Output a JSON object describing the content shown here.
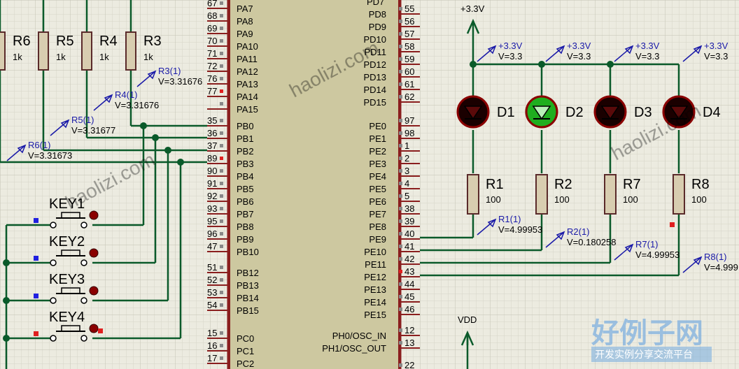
{
  "mcu": {
    "left_pins": [
      {
        "num": "67",
        "name": "PA7"
      },
      {
        "num": "68",
        "name": "PA8"
      },
      {
        "num": "69",
        "name": "PA9"
      },
      {
        "num": "70",
        "name": "PA10"
      },
      {
        "num": "71",
        "name": "PA11"
      },
      {
        "num": "72",
        "name": "PA12"
      },
      {
        "num": "76",
        "name": "PA13"
      },
      {
        "num": "77",
        "name": "PA14"
      },
      {
        "num": "",
        "name": "PA15"
      },
      {
        "num": "35",
        "name": "PB0"
      },
      {
        "num": "36",
        "name": "PB1"
      },
      {
        "num": "37",
        "name": "PB2"
      },
      {
        "num": "89",
        "name": "PB3"
      },
      {
        "num": "90",
        "name": "PB4"
      },
      {
        "num": "91",
        "name": "PB5"
      },
      {
        "num": "92",
        "name": "PB6"
      },
      {
        "num": "93",
        "name": "PB7"
      },
      {
        "num": "95",
        "name": "PB8"
      },
      {
        "num": "96",
        "name": "PB9"
      },
      {
        "num": "47",
        "name": "PB10"
      },
      {
        "num": "51",
        "name": "PB12"
      },
      {
        "num": "52",
        "name": "PB13"
      },
      {
        "num": "53",
        "name": "PB14"
      },
      {
        "num": "54",
        "name": "PB15"
      },
      {
        "num": "15",
        "name": "PC0"
      },
      {
        "num": "16",
        "name": "PC1"
      },
      {
        "num": "17",
        "name": "PC2"
      }
    ],
    "right_pins": [
      {
        "num": "55",
        "name": "PD8"
      },
      {
        "num": "56",
        "name": "PD9"
      },
      {
        "num": "57",
        "name": "PD10"
      },
      {
        "num": "58",
        "name": "PD11"
      },
      {
        "num": "59",
        "name": "PD12"
      },
      {
        "num": "60",
        "name": "PD13"
      },
      {
        "num": "61",
        "name": "PD14"
      },
      {
        "num": "62",
        "name": "PD15"
      },
      {
        "num": "97",
        "name": "PE0"
      },
      {
        "num": "98",
        "name": "PE1"
      },
      {
        "num": "1",
        "name": "PE2"
      },
      {
        "num": "2",
        "name": "PE3"
      },
      {
        "num": "3",
        "name": "PE4"
      },
      {
        "num": "4",
        "name": "PE5"
      },
      {
        "num": "5",
        "name": "PE6"
      },
      {
        "num": "38",
        "name": "PE7"
      },
      {
        "num": "39",
        "name": "PE8"
      },
      {
        "num": "40",
        "name": "PE9"
      },
      {
        "num": "41",
        "name": "PE10"
      },
      {
        "num": "42",
        "name": "PE11"
      },
      {
        "num": "43",
        "name": "PE12"
      },
      {
        "num": "44",
        "name": "PE13"
      },
      {
        "num": "45",
        "name": "PE14"
      },
      {
        "num": "46",
        "name": "PE15"
      },
      {
        "num": "12",
        "name": "PH0/OSC_IN"
      },
      {
        "num": "13",
        "name": "PH1/OSC_OUT"
      },
      {
        "num": "22",
        "name": ""
      }
    ],
    "top_right_partial": "PD7"
  },
  "left_resistors": [
    {
      "ref": "R6",
      "value": "1k"
    },
    {
      "ref": "R5",
      "value": "1k"
    },
    {
      "ref": "R4",
      "value": "1k"
    },
    {
      "ref": "R3",
      "value": "1k"
    }
  ],
  "left_probes": [
    {
      "label": "R3(1)",
      "value": "V=3.31676"
    },
    {
      "label": "R4(1)",
      "value": "V=3.31676"
    },
    {
      "label": "R5(1)",
      "value": "V=3.31677"
    },
    {
      "label": "R6(1)",
      "value": "V=3.31673"
    }
  ],
  "keys": [
    "KEY1",
    "KEY2",
    "KEY3",
    "KEY4"
  ],
  "power": {
    "label": "+3.3V",
    "vdd": "VDD"
  },
  "rail_probes": [
    {
      "label": "+3.3V",
      "value": "V=3.3"
    },
    {
      "label": "+3.3V",
      "value": "V=3.3"
    },
    {
      "label": "+3.3V",
      "value": "V=3.3"
    },
    {
      "label": "+3.3V",
      "value": "V=3.3"
    }
  ],
  "leds": [
    {
      "ref": "D1",
      "lit": false
    },
    {
      "ref": "D2",
      "lit": true
    },
    {
      "ref": "D3",
      "lit": false
    },
    {
      "ref": "D4",
      "lit": false
    }
  ],
  "led_resistors": [
    {
      "ref": "R1",
      "value": "100"
    },
    {
      "ref": "R2",
      "value": "100"
    },
    {
      "ref": "R7",
      "value": "100"
    },
    {
      "ref": "R8",
      "value": "100"
    }
  ],
  "led_probes": [
    {
      "label": "R1(1)",
      "value": "V=4.99953"
    },
    {
      "label": "R2(1)",
      "value": "V=0.180258"
    },
    {
      "label": "R7(1)",
      "value": "V=4.99953"
    },
    {
      "label": "R8(1)",
      "value": "V=4.999"
    }
  ],
  "watermark": {
    "main": "好例子网",
    "sub": "开发实例分享交流平台",
    "tile": "haolizi.com"
  },
  "colors": {
    "wire": "#0a5a2a",
    "led_off": "#1a0000",
    "led_on": "#1fae1f",
    "led_ring": "#8a0000",
    "probe_text": "#1a1aa8",
    "resistor_fill": "#d8cdb0",
    "chip_fill": "#cdc8a0"
  }
}
